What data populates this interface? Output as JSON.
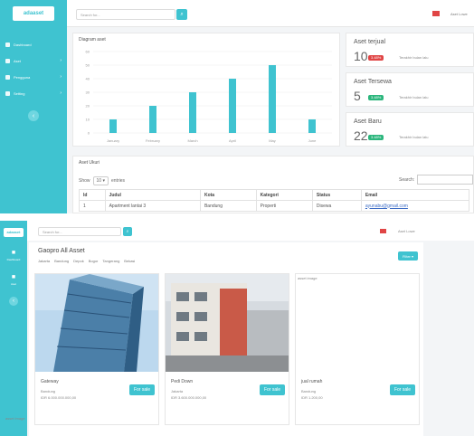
{
  "screen1": {
    "logo": "adaaset",
    "sidebar": {
      "items": [
        {
          "label": "Dashboard",
          "icon": "dashboard-icon"
        },
        {
          "label": "Aset",
          "icon": "building-icon"
        },
        {
          "label": "Pengguna",
          "icon": "users-icon"
        },
        {
          "label": "Setting",
          "icon": "gear-icon"
        }
      ],
      "collapse_glyph": "‹"
    },
    "header": {
      "search_placeholder": "Search for...",
      "search_glyph": "⌕",
      "user_name": "Aset Lowe"
    },
    "chart_card": {
      "title": "Diagram aset"
    },
    "chart_data": {
      "type": "bar",
      "categories": [
        "January",
        "February",
        "March",
        "April",
        "May",
        "June"
      ],
      "values": [
        10,
        20,
        30,
        40,
        50,
        10
      ],
      "ylim": [
        0,
        60
      ],
      "yticks": [
        0,
        10,
        20,
        30,
        40,
        50,
        60
      ],
      "grid": true,
      "color": "#3fc3d0"
    },
    "stats": [
      {
        "title": "Aset terjual",
        "value": "10",
        "badge": "3.48%",
        "badge_color": "#e04545",
        "note": "Terakhir bulan lalu"
      },
      {
        "title": "Aset Tersewa",
        "value": "5",
        "badge": "3.48%",
        "badge_color": "#2cb67d",
        "note": "Terakhir bulan lalu"
      },
      {
        "title": "Aset Baru",
        "value": "22",
        "badge": "3.48%",
        "badge_color": "#2cb67d",
        "note": "Terakhir bulan lalu"
      }
    ],
    "table_card": {
      "title": "Aset Ukuri",
      "show_label": "Show",
      "entries_value": "10",
      "entries_label": "entries",
      "search_label": "Search:",
      "columns": [
        "Id",
        "Judul",
        "Kota",
        "Kategori",
        "Status",
        "Email"
      ],
      "rows": [
        [
          "1",
          "Apartment lantai 3",
          "Bandung",
          "Properti",
          "Disewa",
          "ayunabu@gmail.com"
        ]
      ]
    }
  },
  "screen2": {
    "logo": "adaaset",
    "sidebar": {
      "items": [
        {
          "label": "Dashboard",
          "icon": "home-icon"
        },
        {
          "label": "Aset",
          "icon": "building-icon"
        }
      ],
      "collapse_glyph": "‹"
    },
    "header": {
      "search_placeholder": "Search for...",
      "search_glyph": "⌕",
      "user_name": "Aset Lowe"
    },
    "title": "Gaopro All Asset",
    "cities": [
      "Jakarta",
      "Bandung",
      "Depok",
      "Bogor",
      "Tangerang",
      "Bekasi"
    ],
    "filter_label": "Filter",
    "listings": [
      {
        "name": "Gateway",
        "city": "Bandung",
        "price": "IDR 6.000.000.000,00",
        "button": "For sale",
        "photo": "glass-tower"
      },
      {
        "name": "Pedi Down",
        "city": "Jakarta",
        "price": "IDR 3.600.000.000,00",
        "button": "For sale",
        "photo": "apartment-street"
      },
      {
        "name": "jual rumah",
        "city": "Bandung",
        "price": "IDR 1.200,00",
        "button": "For sale",
        "photo": "broken",
        "alt": "asset image"
      }
    ],
    "extra_listing_alt": "asset image"
  }
}
